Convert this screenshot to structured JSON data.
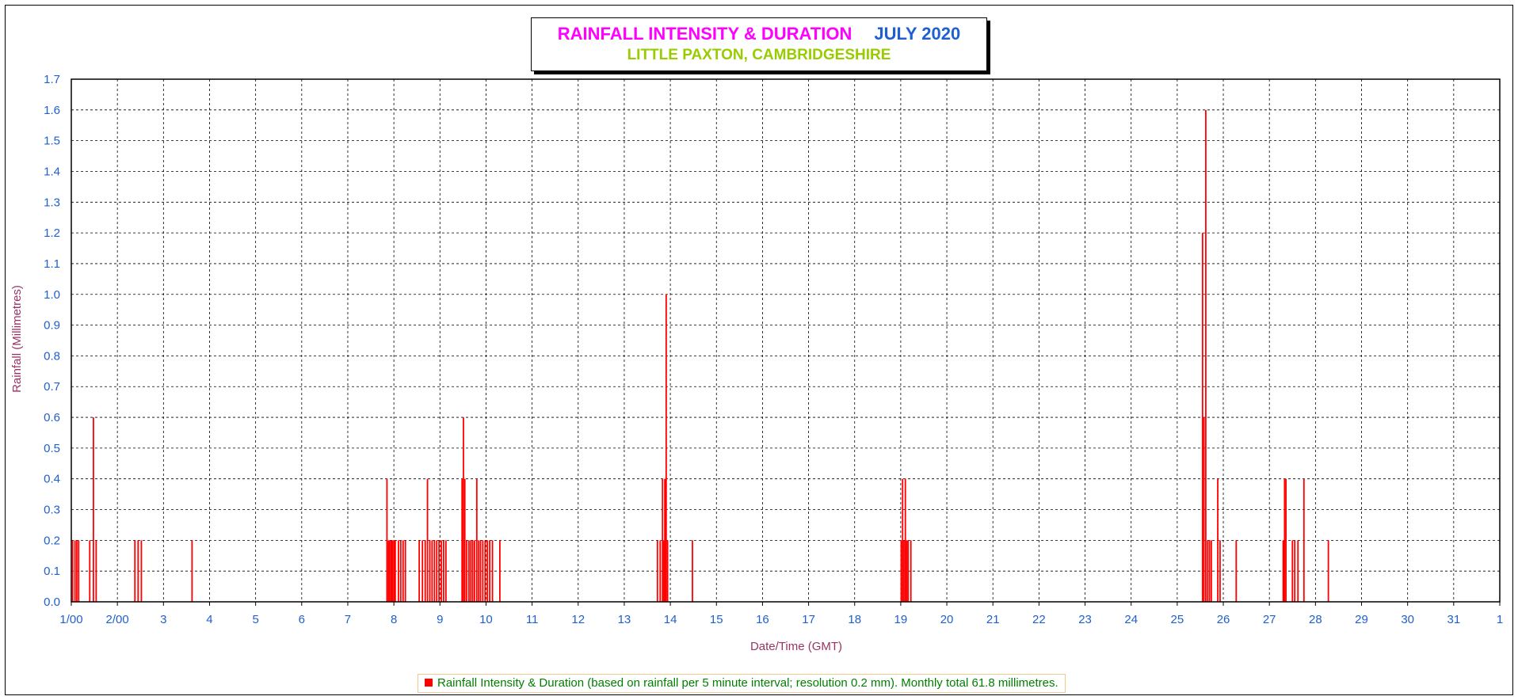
{
  "chart_data": {
    "type": "bar",
    "title": "RAINFALL INTENSITY & DURATION",
    "title_period": "JULY 2020",
    "subtitle": "LITTLE PAXTON, CAMBRIDGESHIRE",
    "xlabel": "Date/Time (GMT)",
    "ylabel": "Rainfall (Millimetres)",
    "ylim": [
      0,
      1.7
    ],
    "yticks": [
      "0.0",
      "0.1",
      "0.2",
      "0.3",
      "0.4",
      "0.5",
      "0.6",
      "0.7",
      "0.8",
      "0.9",
      "1.0",
      "1.1",
      "1.2",
      "1.3",
      "1.4",
      "1.5",
      "1.6",
      "1.7"
    ],
    "xlim": [
      1,
      32
    ],
    "xticks": [
      "1/00",
      "2/00",
      "3",
      "4",
      "5",
      "6",
      "7",
      "8",
      "9",
      "10",
      "11",
      "12",
      "13",
      "14",
      "15",
      "16",
      "17",
      "18",
      "19",
      "20",
      "21",
      "22",
      "23",
      "24",
      "25",
      "26",
      "27",
      "28",
      "29",
      "30",
      "31",
      "1"
    ],
    "grid": true,
    "bar_color": "#ff0000",
    "series": [
      {
        "name": "Rainfall Intensity & Duration (based on rainfall per 5 minute interval; resolution 0.2 mm). Monthly total 61.8 millimetres.",
        "points": [
          {
            "x": 1.03,
            "y": 0.2
          },
          {
            "x": 1.08,
            "y": 0.2
          },
          {
            "x": 1.12,
            "y": 0.2
          },
          {
            "x": 1.16,
            "y": 0.2
          },
          {
            "x": 1.4,
            "y": 0.2
          },
          {
            "x": 1.48,
            "y": 0.6
          },
          {
            "x": 1.54,
            "y": 0.2
          },
          {
            "x": 2.38,
            "y": 0.2
          },
          {
            "x": 2.45,
            "y": 0.2
          },
          {
            "x": 2.52,
            "y": 0.2
          },
          {
            "x": 3.62,
            "y": 0.2
          },
          {
            "x": 7.85,
            "y": 0.4
          },
          {
            "x": 7.88,
            "y": 0.2
          },
          {
            "x": 7.91,
            "y": 0.2
          },
          {
            "x": 7.94,
            "y": 0.2
          },
          {
            "x": 7.97,
            "y": 0.2
          },
          {
            "x": 8.0,
            "y": 0.2
          },
          {
            "x": 8.03,
            "y": 0.2
          },
          {
            "x": 8.1,
            "y": 0.2
          },
          {
            "x": 8.15,
            "y": 0.2
          },
          {
            "x": 8.2,
            "y": 0.2
          },
          {
            "x": 8.25,
            "y": 0.2
          },
          {
            "x": 8.55,
            "y": 0.2
          },
          {
            "x": 8.62,
            "y": 0.2
          },
          {
            "x": 8.68,
            "y": 0.2
          },
          {
            "x": 8.73,
            "y": 0.4
          },
          {
            "x": 8.78,
            "y": 0.2
          },
          {
            "x": 8.83,
            "y": 0.2
          },
          {
            "x": 8.88,
            "y": 0.2
          },
          {
            "x": 8.93,
            "y": 0.2
          },
          {
            "x": 8.98,
            "y": 0.2
          },
          {
            "x": 9.03,
            "y": 0.2
          },
          {
            "x": 9.08,
            "y": 0.2
          },
          {
            "x": 9.13,
            "y": 0.2
          },
          {
            "x": 9.48,
            "y": 0.4
          },
          {
            "x": 9.51,
            "y": 0.6
          },
          {
            "x": 9.54,
            "y": 0.4
          },
          {
            "x": 9.58,
            "y": 0.2
          },
          {
            "x": 9.63,
            "y": 0.2
          },
          {
            "x": 9.67,
            "y": 0.2
          },
          {
            "x": 9.71,
            "y": 0.2
          },
          {
            "x": 9.75,
            "y": 0.2
          },
          {
            "x": 9.8,
            "y": 0.4
          },
          {
            "x": 9.84,
            "y": 0.2
          },
          {
            "x": 9.88,
            "y": 0.2
          },
          {
            "x": 9.93,
            "y": 0.2
          },
          {
            "x": 9.98,
            "y": 0.2
          },
          {
            "x": 10.03,
            "y": 0.2
          },
          {
            "x": 10.08,
            "y": 0.2
          },
          {
            "x": 10.14,
            "y": 0.2
          },
          {
            "x": 10.3,
            "y": 0.2
          },
          {
            "x": 13.72,
            "y": 0.2
          },
          {
            "x": 13.78,
            "y": 0.2
          },
          {
            "x": 13.83,
            "y": 0.4
          },
          {
            "x": 13.86,
            "y": 0.2
          },
          {
            "x": 13.88,
            "y": 0.4
          },
          {
            "x": 13.91,
            "y": 1.0
          },
          {
            "x": 13.94,
            "y": 0.2
          },
          {
            "x": 14.48,
            "y": 0.2
          },
          {
            "x": 19.01,
            "y": 0.2
          },
          {
            "x": 19.04,
            "y": 0.4
          },
          {
            "x": 19.07,
            "y": 0.2
          },
          {
            "x": 19.1,
            "y": 0.4
          },
          {
            "x": 19.13,
            "y": 0.2
          },
          {
            "x": 19.16,
            "y": 0.2
          },
          {
            "x": 19.22,
            "y": 0.2
          },
          {
            "x": 25.55,
            "y": 1.2
          },
          {
            "x": 25.58,
            "y": 0.6
          },
          {
            "x": 25.62,
            "y": 1.6
          },
          {
            "x": 25.66,
            "y": 0.2
          },
          {
            "x": 25.7,
            "y": 0.2
          },
          {
            "x": 25.74,
            "y": 0.2
          },
          {
            "x": 25.88,
            "y": 0.4
          },
          {
            "x": 25.93,
            "y": 0.2
          },
          {
            "x": 26.28,
            "y": 0.2
          },
          {
            "x": 27.3,
            "y": 0.2
          },
          {
            "x": 27.33,
            "y": 0.4
          },
          {
            "x": 27.36,
            "y": 0.4
          },
          {
            "x": 27.5,
            "y": 0.2
          },
          {
            "x": 27.55,
            "y": 0.2
          },
          {
            "x": 27.62,
            "y": 0.2
          },
          {
            "x": 27.75,
            "y": 0.4
          },
          {
            "x": 28.28,
            "y": 0.2
          }
        ]
      }
    ]
  }
}
